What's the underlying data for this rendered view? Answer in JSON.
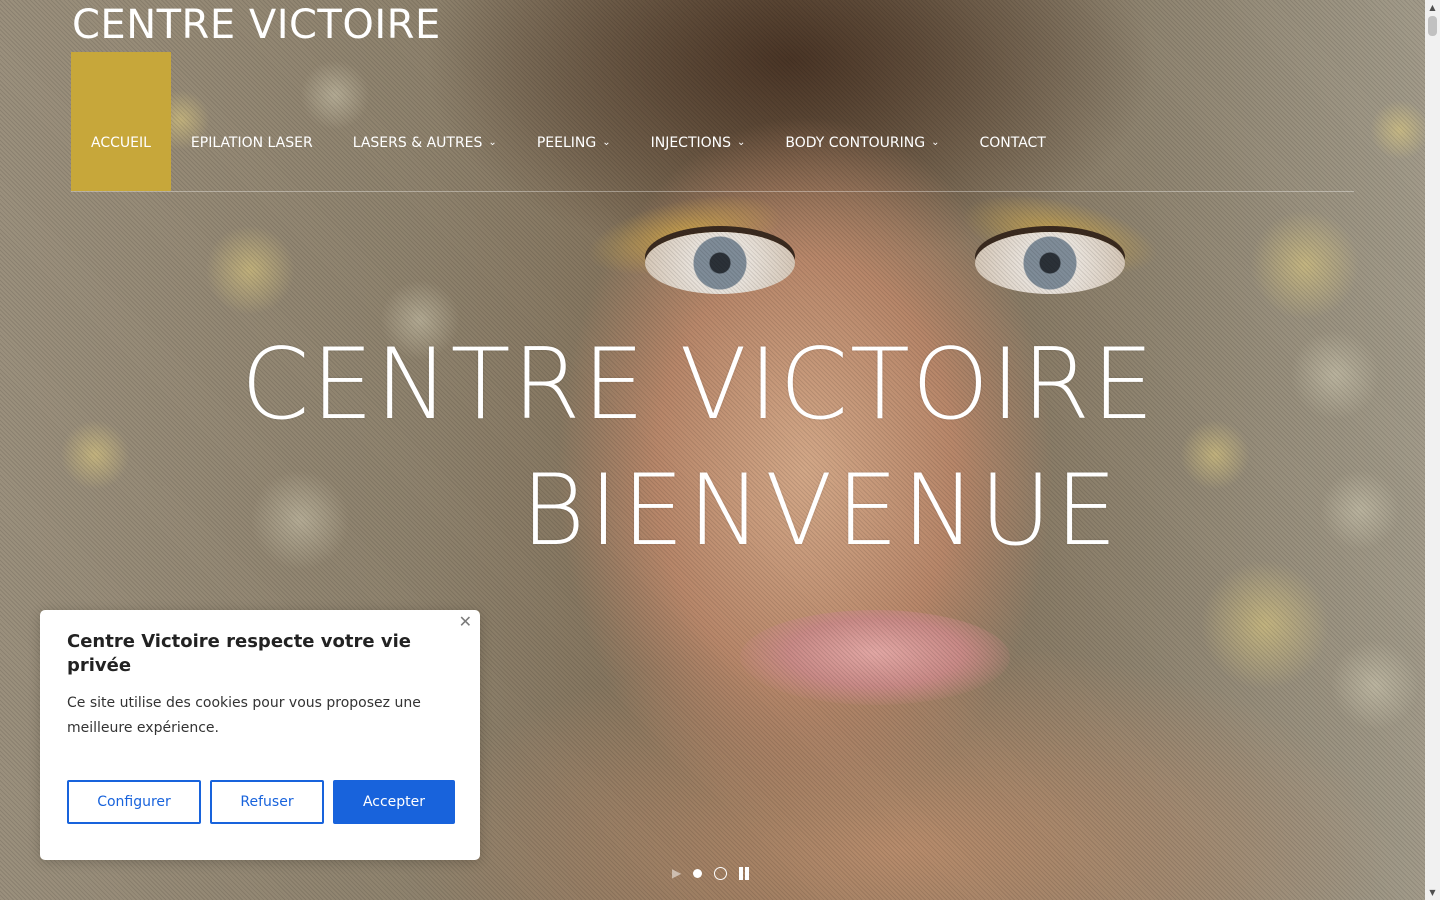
{
  "site": {
    "title": "CENTRE VICTOIRE"
  },
  "nav": {
    "items": [
      {
        "label": "ACCUEIL",
        "active": true,
        "has_submenu": false
      },
      {
        "label": "EPILATION LASER",
        "active": false,
        "has_submenu": false
      },
      {
        "label": "LASERS & AUTRES",
        "active": false,
        "has_submenu": true
      },
      {
        "label": "PEELING",
        "active": false,
        "has_submenu": true
      },
      {
        "label": "INJECTIONS",
        "active": false,
        "has_submenu": true
      },
      {
        "label": "BODY CONTOURING",
        "active": false,
        "has_submenu": true
      },
      {
        "label": "CONTACT",
        "active": false,
        "has_submenu": false
      }
    ],
    "caret_icon": "chevron-down-icon",
    "active_color": "#c7a73a"
  },
  "hero": {
    "line1": "CENTRE VICTOIRE",
    "line2": "BIENVENUE"
  },
  "slider": {
    "play_icon": "play-icon",
    "pause_icon": "pause-icon",
    "slides": 2,
    "current": 1
  },
  "cookie": {
    "title": "Centre Victoire respecte votre vie privée",
    "text": "Ce site utilise des cookies pour vous proposez une meilleure expérience.",
    "close_icon": "close-icon",
    "buttons": {
      "configure": "Configurer",
      "refuse": "Refuser",
      "accept": "Accepter"
    },
    "accent_color": "#1863dc"
  }
}
